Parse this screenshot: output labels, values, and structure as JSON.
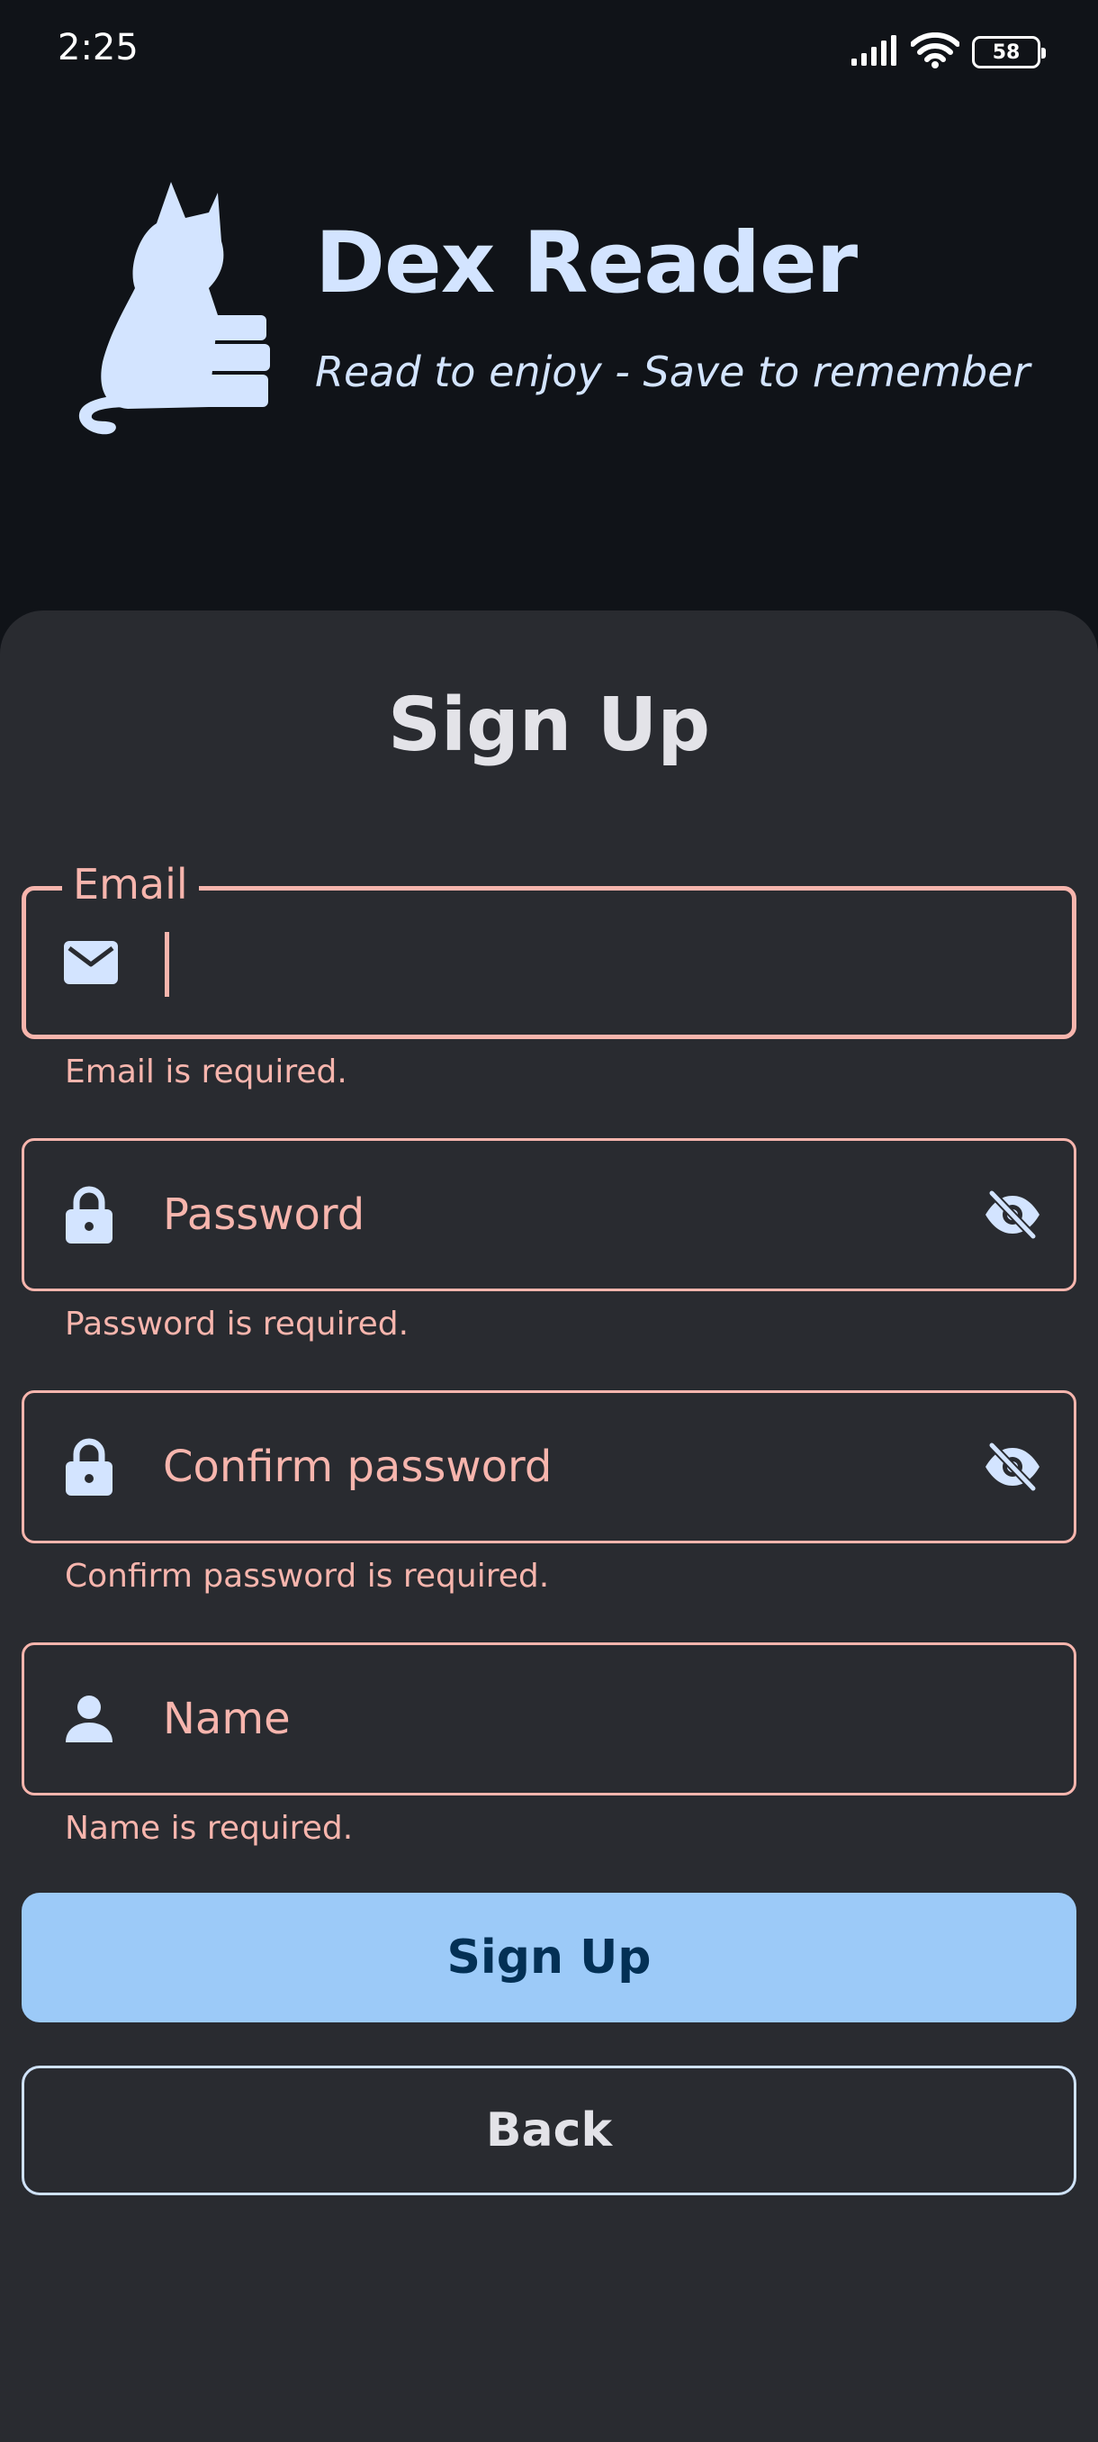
{
  "status_bar": {
    "time": "2:25",
    "battery": "58"
  },
  "header": {
    "title": "Dex Reader",
    "tagline": "Read to enjoy - Save to remember"
  },
  "form": {
    "title": "Sign Up",
    "email": {
      "label": "Email",
      "error": "Email is required."
    },
    "password": {
      "placeholder": "Password",
      "error": "Password is required."
    },
    "confirm_password": {
      "placeholder": "Confirm password",
      "error": "Confirm password is required."
    },
    "name": {
      "placeholder": "Name",
      "error": "Name is required."
    },
    "signup_button": "Sign Up",
    "back_button": "Back"
  },
  "colors": {
    "accent": "#9ccaf8",
    "error": "#f7b5ad",
    "sheet": "#292b30",
    "background": "#101318",
    "logo": "#d3e4ff"
  },
  "icons": {
    "email": "mail-icon",
    "password": "lock-icon",
    "confirm_password": "lock-icon",
    "name": "person-icon",
    "visibility": "visibility-off-icon"
  }
}
